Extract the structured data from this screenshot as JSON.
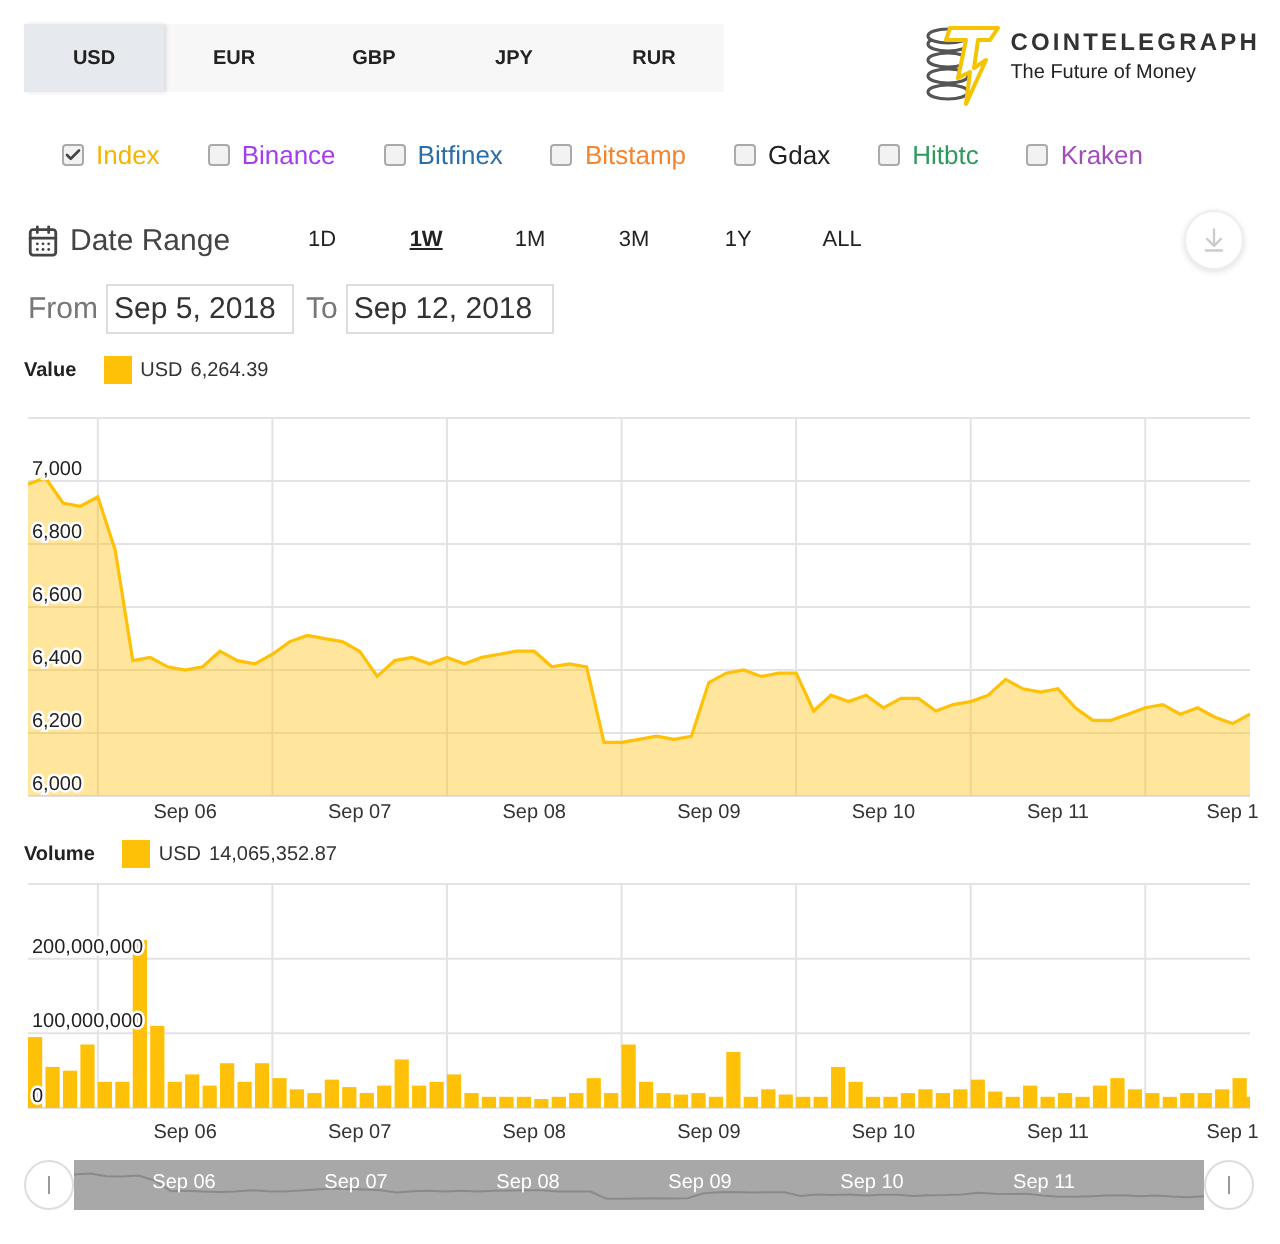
{
  "currency_tabs": [
    {
      "label": "USD",
      "selected": true
    },
    {
      "label": "EUR",
      "selected": false
    },
    {
      "label": "GBP",
      "selected": false
    },
    {
      "label": "JPY",
      "selected": false
    },
    {
      "label": "RUR",
      "selected": false
    }
  ],
  "brand": {
    "name": "COINTELEGRAPH",
    "tagline": "The Future of Money"
  },
  "exchanges": [
    {
      "label": "Index",
      "checked": true,
      "color": "#f5b400"
    },
    {
      "label": "Binance",
      "checked": false,
      "color": "#a43cf0"
    },
    {
      "label": "Bitfinex",
      "checked": false,
      "color": "#2b6ea8"
    },
    {
      "label": "Bitstamp",
      "checked": false,
      "color": "#f5842c"
    },
    {
      "label": "Gdax",
      "checked": false,
      "color": "#222222"
    },
    {
      "label": "Hitbtc",
      "checked": false,
      "color": "#2e9a5c"
    },
    {
      "label": "Kraken",
      "checked": false,
      "color": "#a24cb8"
    }
  ],
  "date_range": {
    "label": "Date Range",
    "ranges": [
      {
        "label": "1D",
        "selected": false
      },
      {
        "label": "1W",
        "selected": true
      },
      {
        "label": "1M",
        "selected": false
      },
      {
        "label": "3M",
        "selected": false
      },
      {
        "label": "1Y",
        "selected": false
      },
      {
        "label": "ALL",
        "selected": false
      }
    ]
  },
  "period": {
    "from_label": "From",
    "from": "Sep 5, 2018",
    "to_label": "To",
    "to": "Sep 12, 2018"
  },
  "value_chart": {
    "title": "Value",
    "legend": {
      "value": "6,264.39"
    },
    "chart_data": {
      "type": "area",
      "grid": true,
      "categories": [
        null,
        null,
        null,
        null,
        null,
        null,
        null,
        null,
        null,
        "Sep 06",
        null,
        null,
        null,
        null,
        null,
        null,
        null,
        null,
        null,
        "Sep 07",
        null,
        null,
        null,
        null,
        null,
        null,
        null,
        null,
        null,
        "Sep 08",
        null,
        null,
        null,
        null,
        null,
        null,
        null,
        null,
        null,
        "Sep 09",
        null,
        null,
        null,
        null,
        null,
        null,
        null,
        null,
        null,
        "Sep 10",
        null,
        null,
        null,
        null,
        null,
        null,
        null,
        null,
        null,
        "Sep 11",
        null,
        null,
        null,
        null,
        null,
        null,
        null,
        null,
        null,
        "Sep 1",
        null
      ],
      "series": [
        {
          "name": "USD",
          "color": "#ffc107",
          "values": [
            6990,
            7010,
            6930,
            6920,
            6950,
            6780,
            6430,
            6440,
            6410,
            6400,
            6410,
            6460,
            6430,
            6420,
            6450,
            6490,
            6510,
            6500,
            6490,
            6460,
            6380,
            6430,
            6440,
            6420,
            6440,
            6420,
            6440,
            6450,
            6460,
            6460,
            6410,
            6420,
            6410,
            6170,
            6170,
            6180,
            6190,
            6180,
            6190,
            6360,
            6390,
            6400,
            6380,
            6390,
            6390,
            6270,
            6320,
            6300,
            6320,
            6280,
            6310,
            6310,
            6270,
            6290,
            6300,
            6320,
            6370,
            6340,
            6330,
            6340,
            6280,
            6240,
            6240,
            6260,
            6280,
            6290,
            6260,
            6280,
            6250,
            6230,
            6260
          ]
        }
      ],
      "ylim": [
        6000,
        7200
      ],
      "yticks": [
        {
          "value": 6000,
          "label": "6,000"
        },
        {
          "value": 6200,
          "label": "6,200"
        },
        {
          "value": 6400,
          "label": "6,400"
        },
        {
          "value": 6600,
          "label": "6,600"
        },
        {
          "value": 6800,
          "label": "6,800"
        },
        {
          "value": 7000,
          "label": "7,000"
        }
      ]
    }
  },
  "volume_chart": {
    "title": "Volume",
    "legend": {
      "value": "14,065,352.87"
    },
    "chart_data": {
      "type": "bar",
      "grid": true,
      "categories": [
        null,
        null,
        null,
        null,
        null,
        null,
        null,
        null,
        null,
        "Sep 06",
        null,
        null,
        null,
        null,
        null,
        null,
        null,
        null,
        null,
        "Sep 07",
        null,
        null,
        null,
        null,
        null,
        null,
        null,
        null,
        null,
        "Sep 08",
        null,
        null,
        null,
        null,
        null,
        null,
        null,
        null,
        null,
        "Sep 09",
        null,
        null,
        null,
        null,
        null,
        null,
        null,
        null,
        null,
        "Sep 10",
        null,
        null,
        null,
        null,
        null,
        null,
        null,
        null,
        null,
        "Sep 11",
        null,
        null,
        null,
        null,
        null,
        null,
        null,
        null,
        null,
        "Sep 1",
        null
      ],
      "series": [
        {
          "name": "USD",
          "color": "#ffc107",
          "values": [
            95000000,
            55000000,
            50000000,
            85000000,
            35000000,
            35000000,
            225000000,
            110000000,
            35000000,
            45000000,
            30000000,
            60000000,
            35000000,
            60000000,
            40000000,
            25000000,
            20000000,
            38000000,
            28000000,
            20000000,
            30000000,
            65000000,
            30000000,
            35000000,
            45000000,
            20000000,
            15000000,
            15000000,
            15000000,
            12000000,
            15000000,
            20000000,
            40000000,
            20000000,
            85000000,
            35000000,
            20000000,
            18000000,
            20000000,
            15000000,
            75000000,
            15000000,
            25000000,
            18000000,
            15000000,
            15000000,
            55000000,
            35000000,
            15000000,
            15000000,
            20000000,
            25000000,
            20000000,
            25000000,
            38000000,
            22000000,
            15000000,
            30000000,
            15000000,
            20000000,
            15000000,
            30000000,
            40000000,
            25000000,
            20000000,
            15000000,
            20000000,
            20000000,
            25000000,
            40000000,
            15000000
          ]
        }
      ],
      "ylim": [
        0,
        300000000
      ],
      "yticks": [
        {
          "value": 0,
          "label": "0"
        },
        {
          "value": 100000000,
          "label": "100,000,000"
        },
        {
          "value": 200000000,
          "label": "200,000,000"
        }
      ]
    }
  },
  "navigator": {
    "labels": [
      "Sep 06",
      "Sep 07",
      "Sep 08",
      "Sep 09",
      "Sep 10",
      "Sep 11"
    ]
  }
}
